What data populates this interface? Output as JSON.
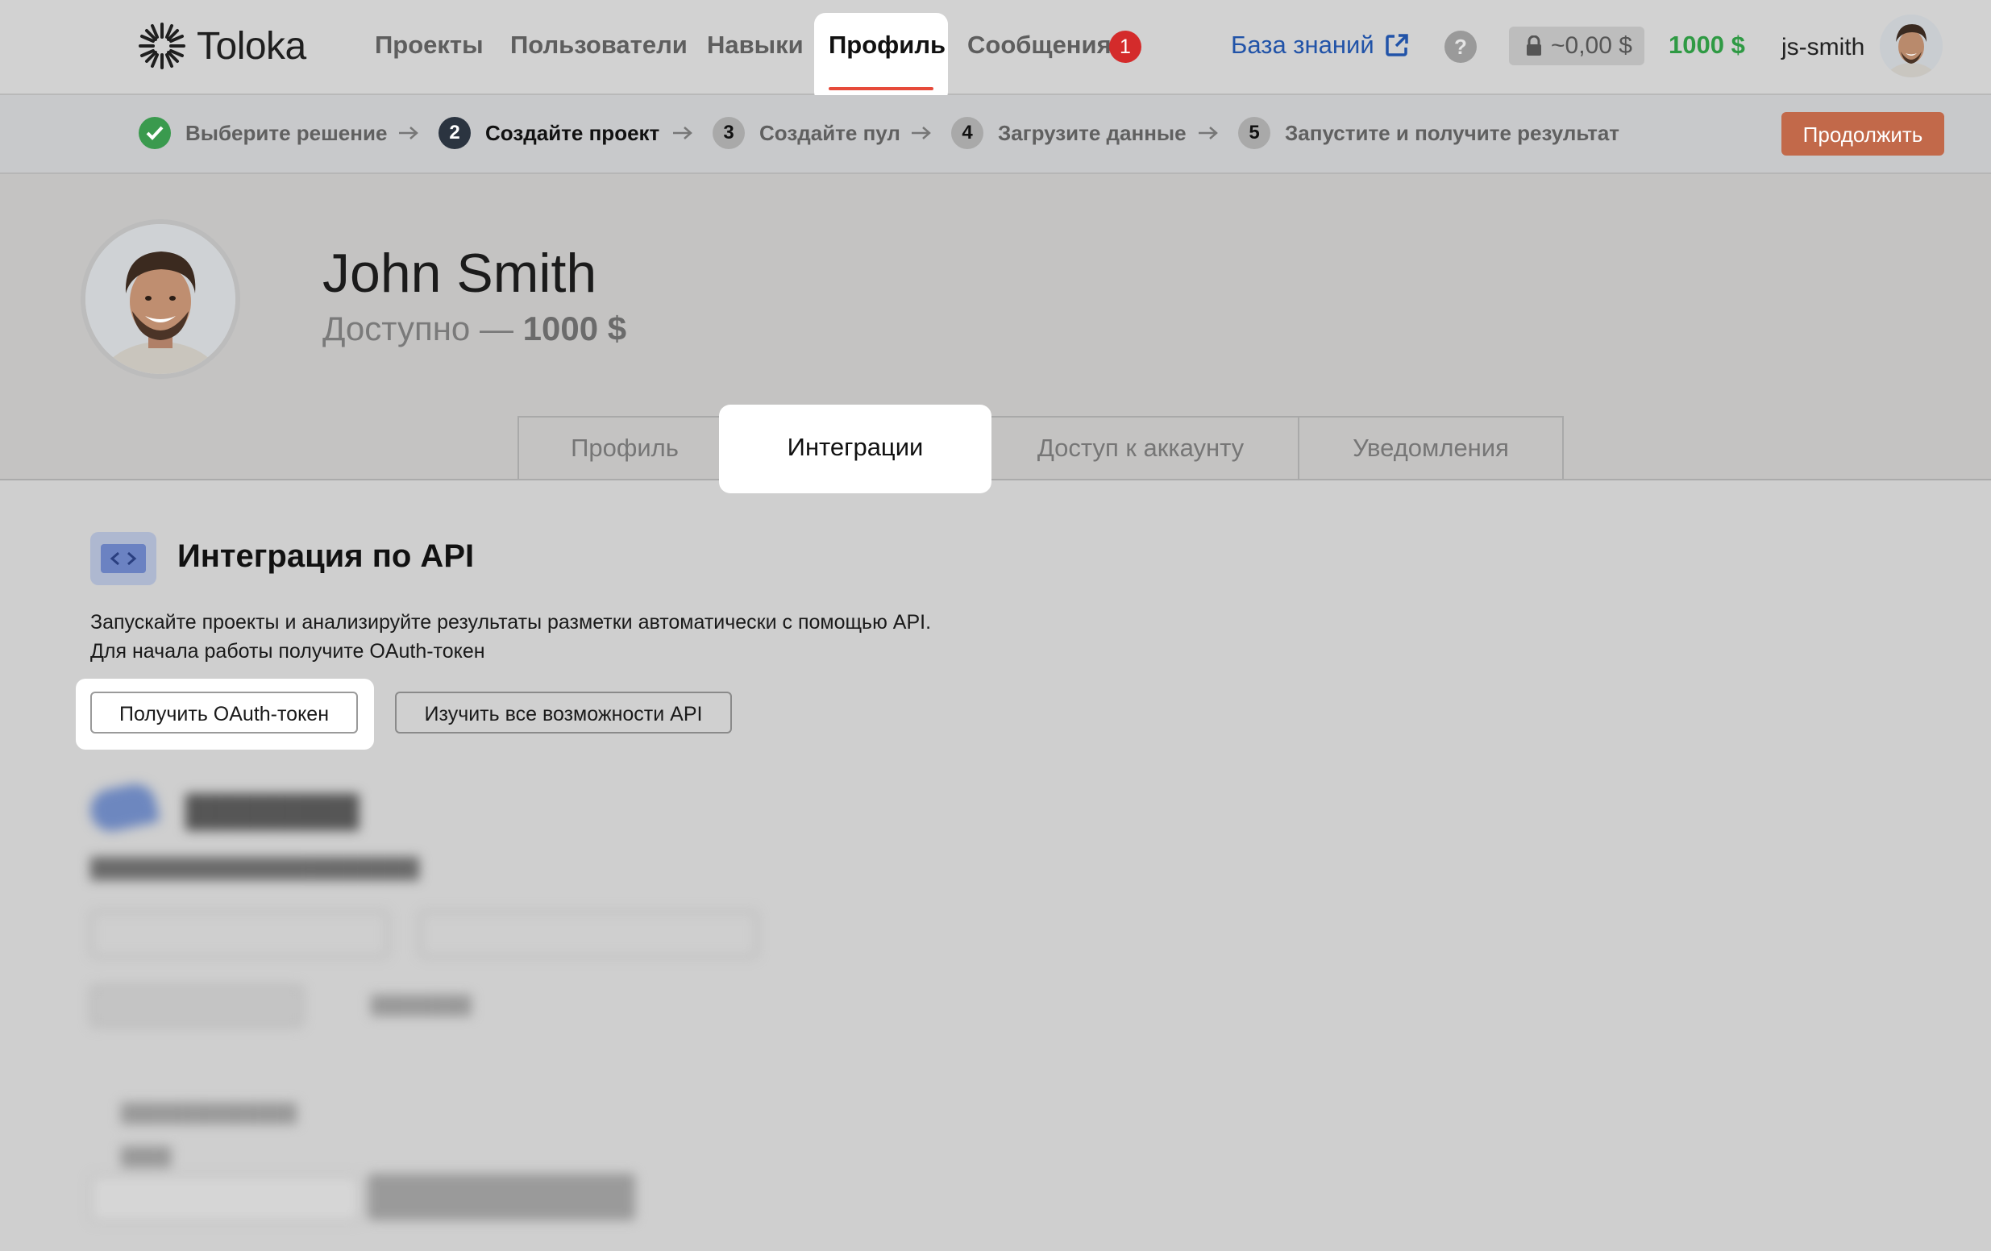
{
  "header": {
    "brand": "Toloka",
    "nav": [
      {
        "label": "Проекты"
      },
      {
        "label": "Пользователи"
      },
      {
        "label": "Навыки"
      },
      {
        "label": "Профиль",
        "active": true
      },
      {
        "label": "Сообщения",
        "badge": "1"
      }
    ],
    "knowledge_base": "База знаний",
    "help": "?",
    "locked_balance": "~0,00 $",
    "balance": "1000 $",
    "username": "js-smith",
    "icons": {
      "logo": "toloka-logo-icon",
      "external": "external-link-icon",
      "lock": "lock-icon"
    }
  },
  "stepper": {
    "steps": [
      {
        "num": "",
        "label": "Выберите решение",
        "state": "done"
      },
      {
        "num": "2",
        "label": "Создайте проект",
        "state": "current"
      },
      {
        "num": "3",
        "label": "Создайте пул",
        "state": "todo"
      },
      {
        "num": "4",
        "label": "Загрузите данные",
        "state": "todo"
      },
      {
        "num": "5",
        "label": "Запустите и получите результат",
        "state": "todo"
      }
    ],
    "continue_label": "Продолжить"
  },
  "profile": {
    "name": "John Smith",
    "available_prefix": "Доступно — ",
    "available_amount": "1000 $",
    "tabs": [
      {
        "label": "Профиль"
      },
      {
        "label": "Интеграции",
        "active": true
      },
      {
        "label": "Доступ к аккаунту"
      },
      {
        "label": "Уведомления"
      }
    ]
  },
  "api": {
    "title": "Интеграция по API",
    "desc_line1": "Запускайте проекты и анализируйте результаты разметки автоматически с помощью API.",
    "desc_line2": "Для начала работы получите OAuth-токен",
    "get_token_label": "Получить OAuth-токен",
    "explore_label": "Изучить все возможности API"
  },
  "colors": {
    "accent_red": "#e64a3a",
    "continue_btn": "#c2694a",
    "balance_green": "#2f9a44",
    "link_blue": "#2153a8",
    "badge_red": "#d42b2b"
  }
}
